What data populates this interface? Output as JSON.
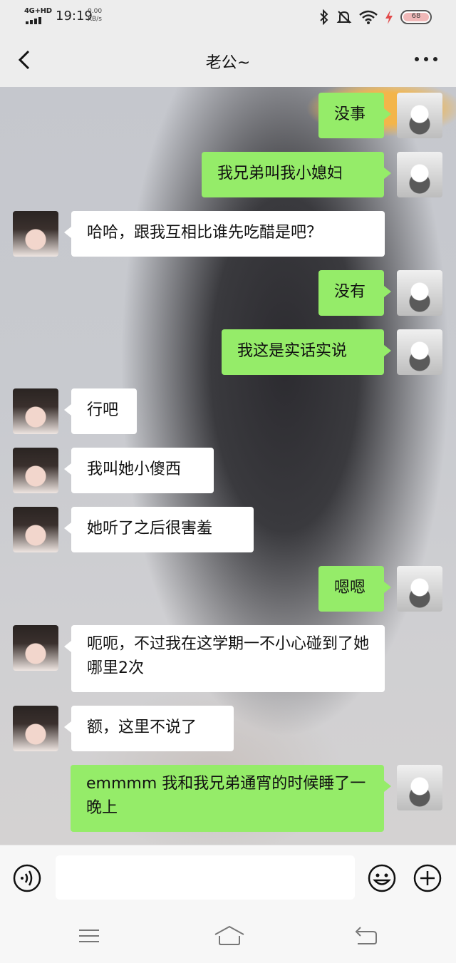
{
  "status_bar": {
    "network": "4G+HD",
    "time": "19:19",
    "speed_value": "0.00",
    "speed_unit": "KB/s",
    "battery": "68",
    "icons": [
      "bluetooth-icon",
      "mute-icon",
      "wifi-icon",
      "charging-icon",
      "battery-icon"
    ]
  },
  "header": {
    "title": "老公~",
    "back_icon": "chevron-left-icon",
    "more_icon": "more-dots-icon"
  },
  "messages": [
    {
      "side": "me",
      "text": "没事"
    },
    {
      "side": "me",
      "text": "我兄弟叫我小媳妇"
    },
    {
      "side": "her",
      "text": "哈哈，跟我互相比谁先吃醋是吧？"
    },
    {
      "side": "me",
      "text": "没有"
    },
    {
      "side": "me",
      "text": "我这是实话实说"
    },
    {
      "side": "her",
      "text": "行吧"
    },
    {
      "side": "her",
      "text": "我叫她小傻西"
    },
    {
      "side": "her",
      "text": "她听了之后很害羞"
    },
    {
      "side": "me",
      "text": "嗯嗯"
    },
    {
      "side": "her",
      "text": "呃呃，不过我在这学期一不小心碰到了她哪里2次"
    },
    {
      "side": "her",
      "text": "额，这里不说了"
    },
    {
      "side": "me",
      "text": "emmmm 我和我兄弟通宵的时候睡了一晚上"
    }
  ],
  "input_bar": {
    "voice_icon": "voice-icon",
    "text_value": "",
    "emoji_icon": "emoji-icon",
    "plus_icon": "plus-icon"
  },
  "nav_bar": {
    "icons": [
      "menu-icon",
      "home-icon",
      "back-nav-icon"
    ]
  },
  "colors": {
    "my_bubble": "#95ec69",
    "her_bubble": "#ffffff",
    "bar_bg": "#ededed"
  }
}
